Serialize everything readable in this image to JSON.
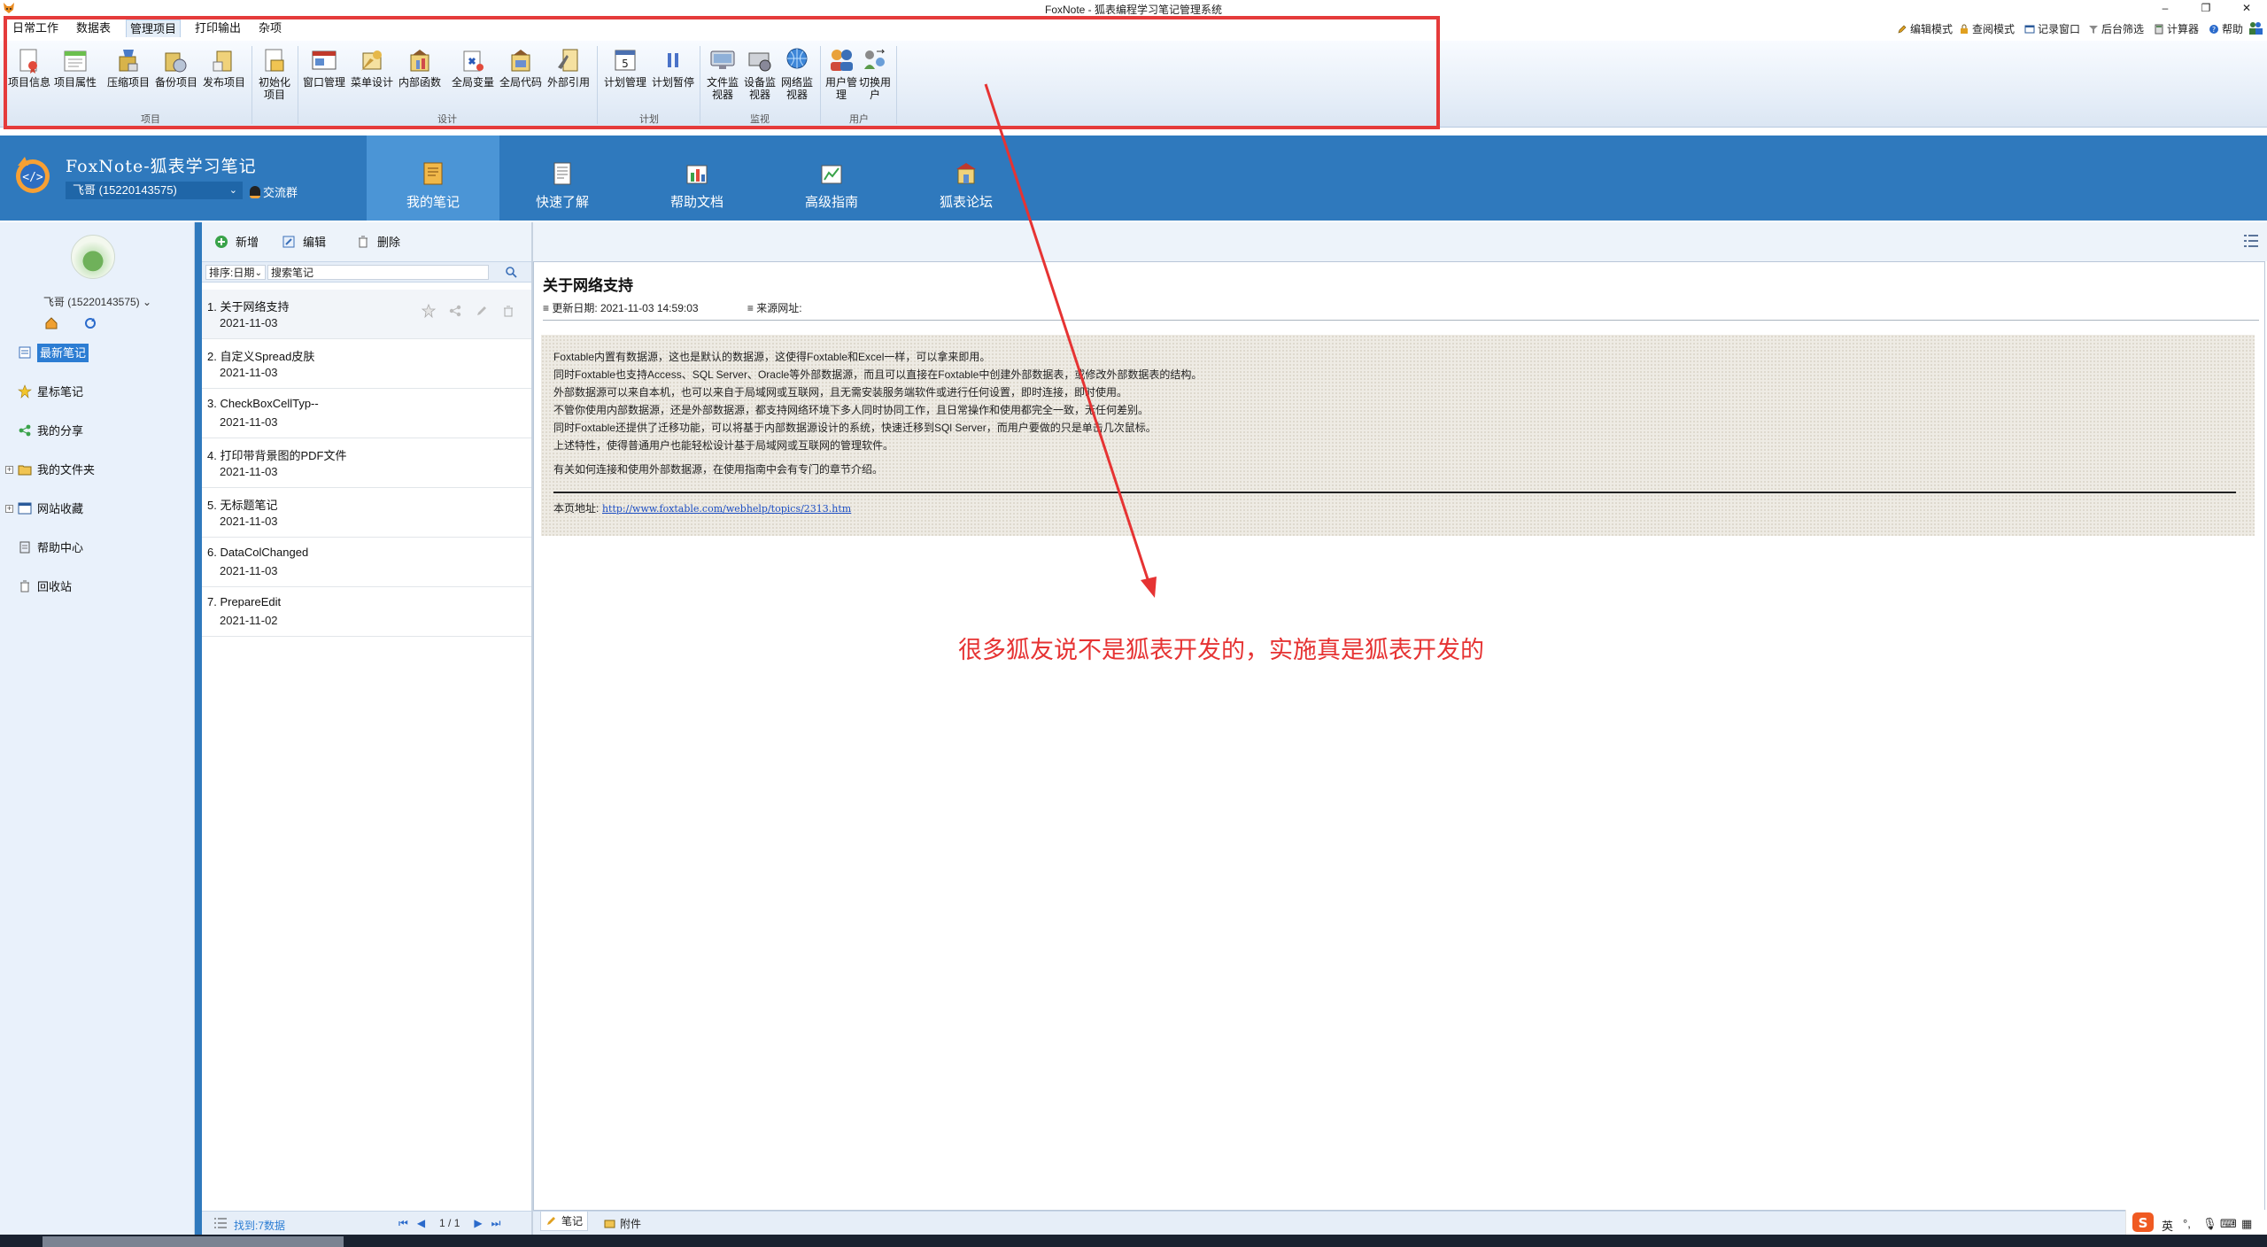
{
  "window": {
    "title": "FoxNote - 狐表编程学习笔记管理系统",
    "minimize": "–",
    "restore": "❐",
    "close": "✕"
  },
  "menu": {
    "items": [
      "日常工作",
      "数据表",
      "管理项目",
      "打印输出",
      "杂项"
    ]
  },
  "quick_actions": [
    "编辑模式",
    "查阅模式",
    "记录窗口",
    "后台筛选",
    "计算器",
    "帮助"
  ],
  "ribbon": {
    "buttons": [
      {
        "label": "项目信息",
        "icon": "project-info-icon"
      },
      {
        "label": "项目属性",
        "icon": "project-properties-icon"
      },
      {
        "label": "压缩项目",
        "icon": "compress-project-icon"
      },
      {
        "label": "备份项目",
        "icon": "backup-project-icon"
      },
      {
        "label": "发布项目",
        "icon": "publish-project-icon"
      },
      {
        "label": "初始化项目",
        "icon": "initialize-project-icon"
      },
      {
        "label": "窗口管理",
        "icon": "window-manager-icon"
      },
      {
        "label": "菜单设计",
        "icon": "menu-design-icon"
      },
      {
        "label": "内部函数",
        "icon": "internal-function-icon"
      },
      {
        "label": "全局变量",
        "icon": "global-variable-icon"
      },
      {
        "label": "全局代码",
        "icon": "global-code-icon"
      },
      {
        "label": "外部引用",
        "icon": "external-reference-icon"
      },
      {
        "label": "计划管理",
        "icon": "schedule-manage-icon"
      },
      {
        "label": "计划暂停",
        "icon": "schedule-pause-icon"
      },
      {
        "label": "文件监视器",
        "icon": "file-monitor-icon"
      },
      {
        "label": "设备监视器",
        "icon": "device-monitor-icon"
      },
      {
        "label": "网络监视器",
        "icon": "network-monitor-icon"
      },
      {
        "label": "用户管理",
        "icon": "user-manage-icon"
      },
      {
        "label": "切换用户",
        "icon": "switch-user-icon"
      }
    ],
    "groups": [
      "项目",
      "设计",
      "计划",
      "监视",
      "用户"
    ]
  },
  "header": {
    "app_title": "FoxNote-狐表学习笔记",
    "user": "飞哥 (15220143575)",
    "chat_group": "交流群",
    "tabs": [
      "我的笔记",
      "快速了解",
      "帮助文档",
      "高级指南",
      "狐表论坛"
    ]
  },
  "sidebar": {
    "user": "飞哥 (15220143575)",
    "items": [
      "最新笔记",
      "星标笔记",
      "我的分享",
      "我的文件夹",
      "网站收藏",
      "帮助中心",
      "回收站"
    ]
  },
  "list": {
    "toolbar": {
      "new": "新增",
      "edit": "编辑",
      "delete": "删除"
    },
    "sort": "排序:日期",
    "search_placeholder": "搜索笔记",
    "notes": [
      {
        "title": "1. 关于网络支持",
        "date": "2021-11-03"
      },
      {
        "title": "2. 自定义Spread皮肤",
        "date": "2021-11-03"
      },
      {
        "title": "3. CheckBoxCellTyp--",
        "date": "2021-11-03"
      },
      {
        "title": "4. 打印带背景图的PDF文件",
        "date": "2021-11-03"
      },
      {
        "title": "5. 无标题笔记",
        "date": "2021-11-03"
      },
      {
        "title": "6. DataColChanged",
        "date": "2021-11-03"
      },
      {
        "title": "7. PrepareEdit",
        "date": "2021-11-02"
      }
    ],
    "footer": {
      "found": "找到:7数据",
      "page": "1 / 1"
    }
  },
  "document": {
    "title": "关于网络支持",
    "updated": "更新日期: 2021-11-03 14:59:03",
    "source": "来源网址:",
    "paragraphs": [
      "Foxtable内置有数据源，这也是默认的数据源，这使得Foxtable和Excel一样，可以拿来即用。",
      "同时Foxtable也支持Access、SQL Server、Oracle等外部数据源，而且可以直接在Foxtable中创建外部数据表，或修改外部数据表的结构。",
      "外部数据源可以来自本机，也可以来自于局域网或互联网，且无需安装服务端软件或进行任何设置，即时连接，即时使用。",
      "不管你使用内部数据源，还是外部数据源，都支持网络环境下多人同时协同工作，且日常操作和使用都完全一致，无任何差别。",
      "同时Foxtable还提供了迁移功能，可以将基于内部数据源设计的系统，快速迁移到SQl Server，而用户要做的只是单击几次鼠标。",
      "上述特性，使得普通用户也能轻松设计基于局域网或互联网的管理软件。",
      "有关如何连接和使用外部数据源，在使用指南中会有专门的章节介绍。"
    ],
    "page_url_label": "本页地址:",
    "page_url": "http://www.foxtable.com/webhelp/topics/2313.htm"
  },
  "annotation": "很多狐友说不是狐表开发的，实施真是狐表开发的",
  "bottom_tabs": [
    "笔记",
    "附件"
  ],
  "ime": {
    "lang": "英"
  },
  "colors": {
    "header": "#2f79bd",
    "active_tab": "#4b95d6",
    "annotation": "#e63333",
    "sidebar": "#e9f1fb"
  }
}
